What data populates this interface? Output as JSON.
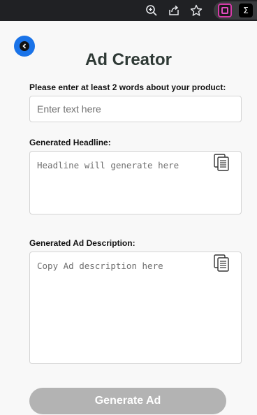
{
  "browser": {
    "icons": [
      "zoom-icon",
      "share-icon",
      "bookmark-star-icon",
      "extension-icon",
      "sigma-extension-icon"
    ],
    "sigma_glyph": "Σ"
  },
  "popup": {
    "title": "Ad Creator",
    "back_icon": "back-arrow-icon",
    "product_label": "Please enter at least 2 words about your product:",
    "product_placeholder": "Enter text here",
    "product_value": "",
    "headline_label": "Generated Headline:",
    "headline_placeholder": "Headline will generate here",
    "description_label": "Generated Ad Description:",
    "description_placeholder": "Copy Ad description here",
    "copy_icon": "copy-icon",
    "generate_label": "Generate Ad",
    "colors": {
      "accent": "#1a73e8",
      "button_disabled": "#b3b3b3",
      "title": "#2f3a36"
    }
  }
}
